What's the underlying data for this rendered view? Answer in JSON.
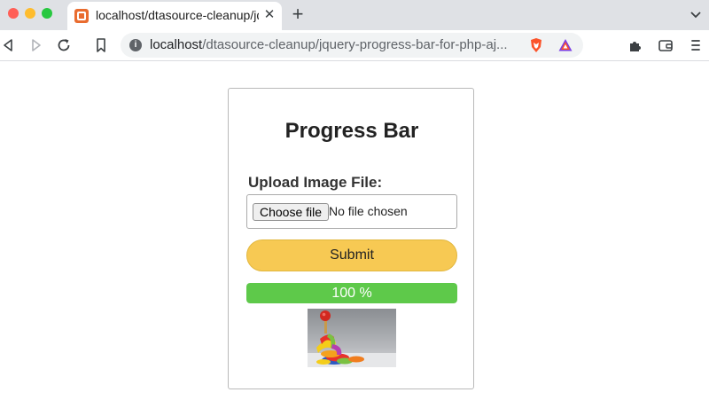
{
  "browser": {
    "tab_title": "localhost/dtasource-cleanup/jquery-progress-bar-for-php-ajax",
    "url_host": "localhost",
    "url_path": "/dtasource-cleanup/jquery-progress-bar-for-php-aj..."
  },
  "page": {
    "heading": "Progress Bar",
    "upload_label": "Upload Image File:",
    "choose_file_label": "Choose file",
    "no_file_text": "No file chosen",
    "submit_label": "Submit",
    "progress_text": "100 %",
    "progress_fraction": 1.0
  },
  "colors": {
    "submit_button": "#f7c953",
    "progress_bar": "#5ec94a"
  },
  "icons": {
    "back": "back-arrow-icon",
    "forward": "forward-arrow-icon",
    "reload": "reload-icon",
    "bookmark": "bookmark-icon",
    "info": "info-icon",
    "brave": "brave-shield-icon",
    "rewards": "brave-rewards-icon",
    "extensions": "puzzle-icon",
    "wallet": "wallet-icon",
    "menu": "menu-icon"
  }
}
